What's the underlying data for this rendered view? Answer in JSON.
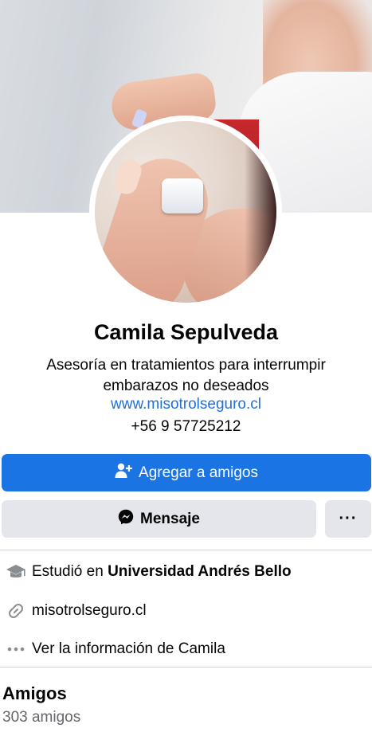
{
  "profile": {
    "name": "Camila Sepulveda",
    "bio": "Asesoría en tratamientos para interrumpir embarazos no deseados",
    "website": "www.misotrolseguro.cl",
    "phone": "+56 9 57725212"
  },
  "actions": {
    "add_friend_label": "Agregar a amigos",
    "message_label": "Mensaje",
    "more_label": "···"
  },
  "info": {
    "studied_prefix": "Estudió en ",
    "studied_school": "Universidad Andrés Bello",
    "link": "misotrolseguro.cl",
    "see_info": "Ver la información de Camila"
  },
  "friends": {
    "title": "Amigos",
    "count": "303 amigos"
  },
  "colors": {
    "primary": "#1b74e4",
    "secondary_button": "#e4e6eb",
    "link": "#216fdb",
    "muted_text": "#65676b"
  },
  "icons": [
    "add-friend-icon",
    "messenger-icon",
    "graduation-cap-icon",
    "link-icon",
    "more-dots-icon"
  ]
}
